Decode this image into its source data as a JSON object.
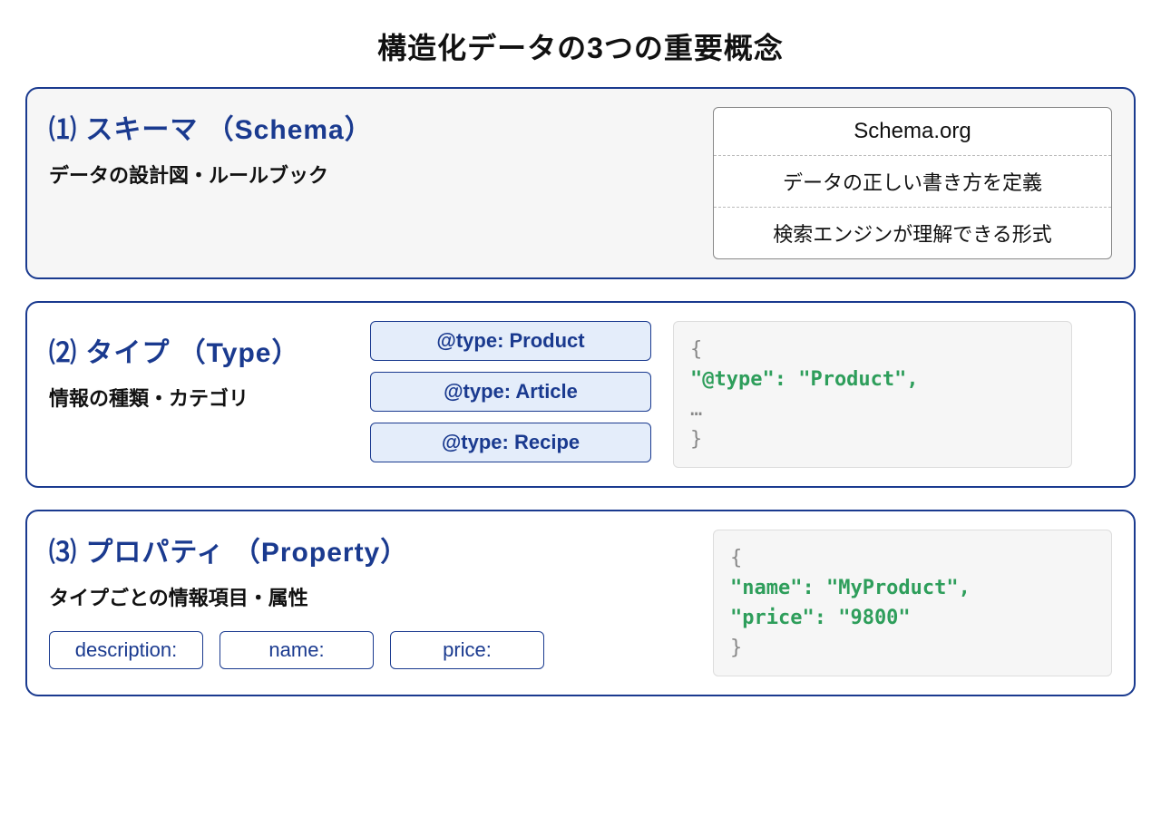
{
  "title": "構造化データの3つの重要概念",
  "sections": {
    "schema": {
      "heading": "⑴ スキーマ （Schema）",
      "sub": "データの設計図・ルールブック",
      "box": {
        "r1": "Schema.org",
        "r2": "データの正しい書き方を定義",
        "r3": "検索エンジンが理解できる形式"
      }
    },
    "type": {
      "heading": "⑵ タイプ （Type）",
      "sub": "情報の種類・カテゴリ",
      "pills": {
        "p1": "@type: Product",
        "p2": "@type: Article",
        "p3": "@type: Recipe"
      },
      "code": {
        "open": "{",
        "l1": "\"@type\": \"Product\",",
        "l2": "…",
        "close": "}"
      }
    },
    "property": {
      "heading": "⑶ プロパティ （Property）",
      "sub": "タイプごとの情報項目・属性",
      "buttons": {
        "b1": "description:",
        "b2": "name:",
        "b3": "price:"
      },
      "code": {
        "open": "{",
        "l1": "\"name\": \"MyProduct\",",
        "l2": "\"price\": \"9800\"",
        "close": "}"
      }
    }
  }
}
